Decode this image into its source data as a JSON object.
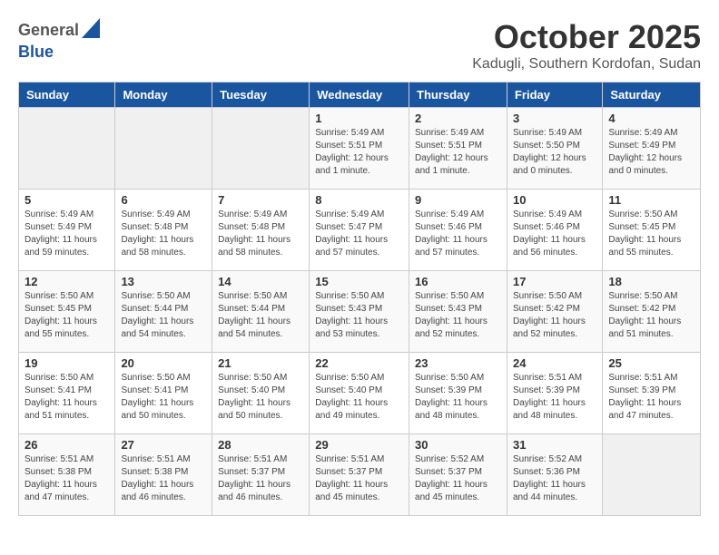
{
  "header": {
    "logo_general": "General",
    "logo_blue": "Blue",
    "month_title": "October 2025",
    "location": "Kadugli, Southern Kordofan, Sudan"
  },
  "weekdays": [
    "Sunday",
    "Monday",
    "Tuesday",
    "Wednesday",
    "Thursday",
    "Friday",
    "Saturday"
  ],
  "weeks": [
    [
      {
        "day": "",
        "info": ""
      },
      {
        "day": "",
        "info": ""
      },
      {
        "day": "",
        "info": ""
      },
      {
        "day": "1",
        "info": "Sunrise: 5:49 AM\nSunset: 5:51 PM\nDaylight: 12 hours\nand 1 minute."
      },
      {
        "day": "2",
        "info": "Sunrise: 5:49 AM\nSunset: 5:51 PM\nDaylight: 12 hours\nand 1 minute."
      },
      {
        "day": "3",
        "info": "Sunrise: 5:49 AM\nSunset: 5:50 PM\nDaylight: 12 hours\nand 0 minutes."
      },
      {
        "day": "4",
        "info": "Sunrise: 5:49 AM\nSunset: 5:49 PM\nDaylight: 12 hours\nand 0 minutes."
      }
    ],
    [
      {
        "day": "5",
        "info": "Sunrise: 5:49 AM\nSunset: 5:49 PM\nDaylight: 11 hours\nand 59 minutes."
      },
      {
        "day": "6",
        "info": "Sunrise: 5:49 AM\nSunset: 5:48 PM\nDaylight: 11 hours\nand 58 minutes."
      },
      {
        "day": "7",
        "info": "Sunrise: 5:49 AM\nSunset: 5:48 PM\nDaylight: 11 hours\nand 58 minutes."
      },
      {
        "day": "8",
        "info": "Sunrise: 5:49 AM\nSunset: 5:47 PM\nDaylight: 11 hours\nand 57 minutes."
      },
      {
        "day": "9",
        "info": "Sunrise: 5:49 AM\nSunset: 5:46 PM\nDaylight: 11 hours\nand 57 minutes."
      },
      {
        "day": "10",
        "info": "Sunrise: 5:49 AM\nSunset: 5:46 PM\nDaylight: 11 hours\nand 56 minutes."
      },
      {
        "day": "11",
        "info": "Sunrise: 5:50 AM\nSunset: 5:45 PM\nDaylight: 11 hours\nand 55 minutes."
      }
    ],
    [
      {
        "day": "12",
        "info": "Sunrise: 5:50 AM\nSunset: 5:45 PM\nDaylight: 11 hours\nand 55 minutes."
      },
      {
        "day": "13",
        "info": "Sunrise: 5:50 AM\nSunset: 5:44 PM\nDaylight: 11 hours\nand 54 minutes."
      },
      {
        "day": "14",
        "info": "Sunrise: 5:50 AM\nSunset: 5:44 PM\nDaylight: 11 hours\nand 54 minutes."
      },
      {
        "day": "15",
        "info": "Sunrise: 5:50 AM\nSunset: 5:43 PM\nDaylight: 11 hours\nand 53 minutes."
      },
      {
        "day": "16",
        "info": "Sunrise: 5:50 AM\nSunset: 5:43 PM\nDaylight: 11 hours\nand 52 minutes."
      },
      {
        "day": "17",
        "info": "Sunrise: 5:50 AM\nSunset: 5:42 PM\nDaylight: 11 hours\nand 52 minutes."
      },
      {
        "day": "18",
        "info": "Sunrise: 5:50 AM\nSunset: 5:42 PM\nDaylight: 11 hours\nand 51 minutes."
      }
    ],
    [
      {
        "day": "19",
        "info": "Sunrise: 5:50 AM\nSunset: 5:41 PM\nDaylight: 11 hours\nand 51 minutes."
      },
      {
        "day": "20",
        "info": "Sunrise: 5:50 AM\nSunset: 5:41 PM\nDaylight: 11 hours\nand 50 minutes."
      },
      {
        "day": "21",
        "info": "Sunrise: 5:50 AM\nSunset: 5:40 PM\nDaylight: 11 hours\nand 50 minutes."
      },
      {
        "day": "22",
        "info": "Sunrise: 5:50 AM\nSunset: 5:40 PM\nDaylight: 11 hours\nand 49 minutes."
      },
      {
        "day": "23",
        "info": "Sunrise: 5:50 AM\nSunset: 5:39 PM\nDaylight: 11 hours\nand 48 minutes."
      },
      {
        "day": "24",
        "info": "Sunrise: 5:51 AM\nSunset: 5:39 PM\nDaylight: 11 hours\nand 48 minutes."
      },
      {
        "day": "25",
        "info": "Sunrise: 5:51 AM\nSunset: 5:39 PM\nDaylight: 11 hours\nand 47 minutes."
      }
    ],
    [
      {
        "day": "26",
        "info": "Sunrise: 5:51 AM\nSunset: 5:38 PM\nDaylight: 11 hours\nand 47 minutes."
      },
      {
        "day": "27",
        "info": "Sunrise: 5:51 AM\nSunset: 5:38 PM\nDaylight: 11 hours\nand 46 minutes."
      },
      {
        "day": "28",
        "info": "Sunrise: 5:51 AM\nSunset: 5:37 PM\nDaylight: 11 hours\nand 46 minutes."
      },
      {
        "day": "29",
        "info": "Sunrise: 5:51 AM\nSunset: 5:37 PM\nDaylight: 11 hours\nand 45 minutes."
      },
      {
        "day": "30",
        "info": "Sunrise: 5:52 AM\nSunset: 5:37 PM\nDaylight: 11 hours\nand 45 minutes."
      },
      {
        "day": "31",
        "info": "Sunrise: 5:52 AM\nSunset: 5:36 PM\nDaylight: 11 hours\nand 44 minutes."
      },
      {
        "day": "",
        "info": ""
      }
    ]
  ]
}
